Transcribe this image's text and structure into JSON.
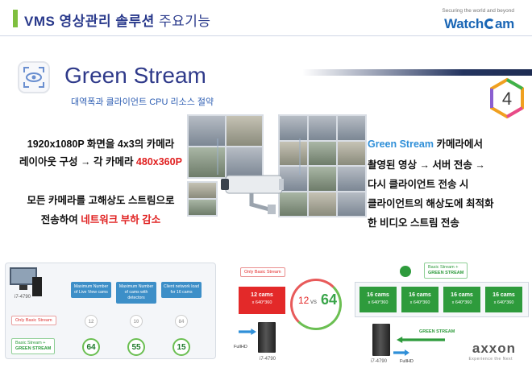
{
  "header": {
    "title_bold": "VMS 영상관리 솔루션",
    "title_light": "주요기능",
    "brand_tagline": "Securing the world and beyond",
    "brand_name_a": "Watch",
    "brand_name_b": "am"
  },
  "section": {
    "title": "Green Stream",
    "subtitle": "대역폭과 클라이언트 CPU 리소스 절약",
    "badge_number": "4"
  },
  "left_text": {
    "line1": "1920x1080P 화면을 4x3의 카메라",
    "line2_a": "레이아웃 구성 → 각 카메라 ",
    "line2_b": "480x360P",
    "line3": "모든 카메라를 고해상도 스트림으로",
    "line4_a": "전송하여 ",
    "line4_b": "네트워크 부하 감소"
  },
  "right_text": {
    "line1_a": "Green Stream",
    "line1_b": " 카메라에서",
    "line2": "촬영된 영상 → 서버 전송 →",
    "line3": "다시 클라이언트 전송 시",
    "line4": "클라이언트의 해상도에 최적화",
    "line5": "한 비디오 스트림 전송"
  },
  "bottom_left": {
    "cpu_label": "i7-4790",
    "col1": "Maximum Number of Live View cams",
    "col2": "Maximum Number of cams with detectors",
    "col3": "Client network load for 16 cams",
    "row1_label": "Only Basic Stream",
    "row2_label_a": "Basic Stream +",
    "row2_label_b": "GREEN STREAM",
    "row1_values": [
      "12",
      "10",
      "84"
    ],
    "row2_values": [
      "64",
      "55",
      "15"
    ]
  },
  "bottom_mid": {
    "only_basic_label": "Only Basic Stream",
    "monitor_title": "12 cams",
    "monitor_sub": "x 640*360",
    "fullhd": "FullHD",
    "cpu_label": "i7-4790",
    "vs_left": "12",
    "vs_word": "vs",
    "vs_right": "64"
  },
  "bottom_right": {
    "label_a": "Basic Stream +",
    "label_b": "GREEN STREAM",
    "monitors": [
      {
        "title": "16 cams",
        "sub": "x 640*360"
      },
      {
        "title": "16 cams",
        "sub": "x 640*360"
      },
      {
        "title": "16 cams",
        "sub": "x 640*360"
      },
      {
        "title": "16 cams",
        "sub": "x 640*360"
      }
    ],
    "green_stream_arrow": "GREEN STREAM",
    "fullhd": "FullHD",
    "cpu_label": "i7-4790",
    "axxon_logo": "axxon",
    "axxon_tagline": "Experience the Next"
  },
  "colors": {
    "navy": "#2f3a8a",
    "red": "#e02020",
    "green": "#2e9b3c",
    "blue": "#2f8fd8"
  }
}
